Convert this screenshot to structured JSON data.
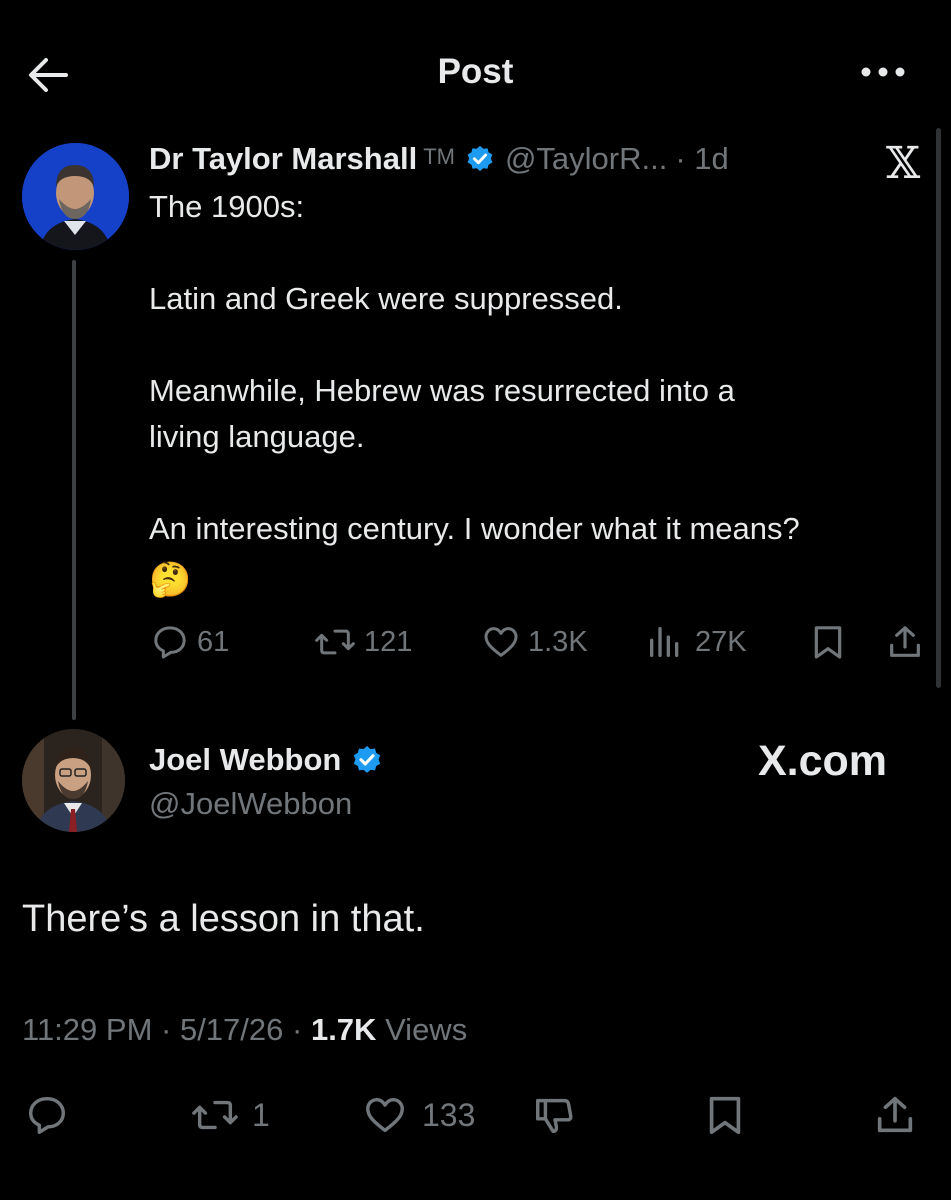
{
  "header": {
    "title": "Post"
  },
  "original_tweet": {
    "author_name": "Dr Taylor Marshall",
    "tm": "TM",
    "handle": "@TaylorR...",
    "time": "· 1d",
    "text": "The 1900s:\n\nLatin and Greek were suppressed.\n\nMeanwhile, Hebrew was resurrected into a\nliving language.\n\nAn interesting century. I wonder what it means?",
    "emoji": "🤔",
    "replies": "61",
    "reposts": "121",
    "likes": "1.3K",
    "views": "27K"
  },
  "reply_tweet": {
    "author_name": "Joel Webbon",
    "handle": "@JoelWebbon",
    "text": "There’s a lesson in that.",
    "time": "11:29 PM",
    "date": "5/17/26",
    "views_count": "1.7K",
    "views_label": "Views",
    "reposts": "1",
    "likes": "133"
  },
  "watermark": {
    "logo": "𝕏",
    "site": "X.com"
  },
  "colors": {
    "background": "#000000",
    "text": "#e7e9ea",
    "muted": "#71767b",
    "verified": "#1d9bf0"
  }
}
